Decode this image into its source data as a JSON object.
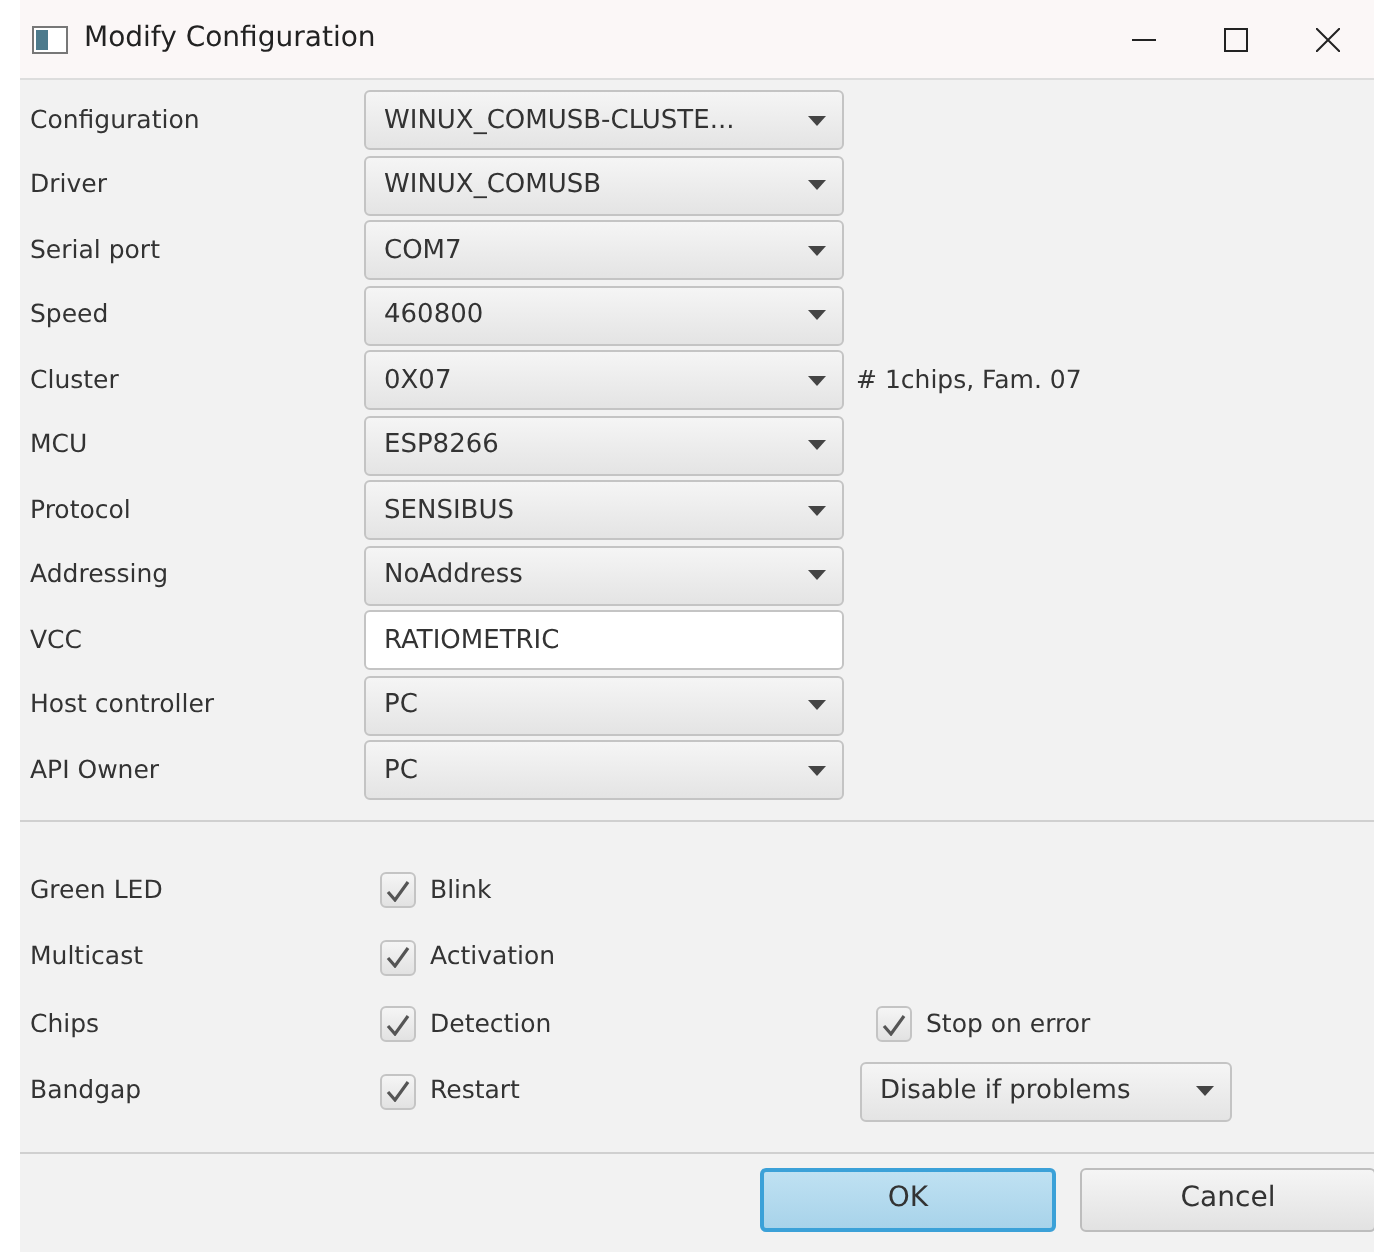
{
  "window": {
    "title": "Modify Configuration"
  },
  "fields": [
    {
      "label": "Configuration",
      "kind": "combo",
      "value": "WINUX_COMUSB-CLUSTE..."
    },
    {
      "label": "Driver",
      "kind": "combo",
      "value": "WINUX_COMUSB"
    },
    {
      "label": "Serial port",
      "kind": "combo",
      "value": "COM7"
    },
    {
      "label": "Speed",
      "kind": "combo",
      "value": "460800"
    },
    {
      "label": "Cluster",
      "kind": "combo",
      "value": "0X07",
      "note": "# 1chips, Fam. 07"
    },
    {
      "label": "MCU",
      "kind": "combo",
      "value": "ESP8266"
    },
    {
      "label": "Protocol",
      "kind": "combo",
      "value": "SENSIBUS"
    },
    {
      "label": "Addressing",
      "kind": "combo",
      "value": "NoAddress"
    },
    {
      "label": "VCC",
      "kind": "text",
      "value": "RATIOMETRIC"
    },
    {
      "label": "Host controller",
      "kind": "combo",
      "value": "PC"
    },
    {
      "label": "API Owner",
      "kind": "combo",
      "value": "PC"
    }
  ],
  "options": [
    {
      "label": "Green LED",
      "checkbox": {
        "text": "Blink",
        "checked": true
      }
    },
    {
      "label": "Multicast",
      "checkbox": {
        "text": "Activation",
        "checked": true
      }
    },
    {
      "label": "Chips",
      "checkbox": {
        "text": "Detection",
        "checked": true
      },
      "extra": {
        "kind": "checkbox",
        "text": "Stop on error",
        "checked": true
      }
    },
    {
      "label": "Bandgap",
      "checkbox": {
        "text": "Restart",
        "checked": true
      },
      "extra": {
        "kind": "combo",
        "value": "Disable if problems"
      }
    }
  ],
  "buttons": [
    {
      "label": "OK",
      "default": true
    },
    {
      "label": "Cancel",
      "default": false
    }
  ]
}
